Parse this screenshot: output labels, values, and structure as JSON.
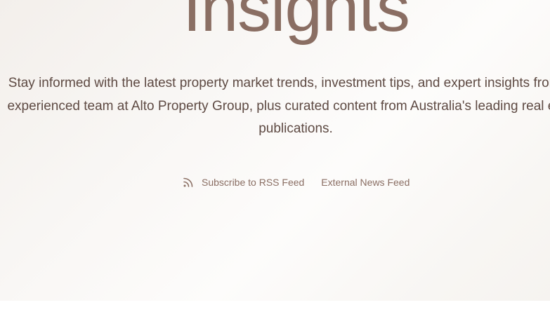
{
  "hero": {
    "title": "Insights",
    "description_lines": [
      "Stay informed with the latest property market trends, investment tips, and expert insights from our",
      "experienced team at Alto Property Group, plus curated content from Australia's leading real estate",
      "publications."
    ]
  },
  "feeds": {
    "rss_icon": "rss-icon",
    "rss_label": "Subscribe to RSS Feed",
    "external_label": "External News Feed"
  },
  "colors": {
    "accent": "#8a6e63",
    "text": "#5e4a43"
  }
}
